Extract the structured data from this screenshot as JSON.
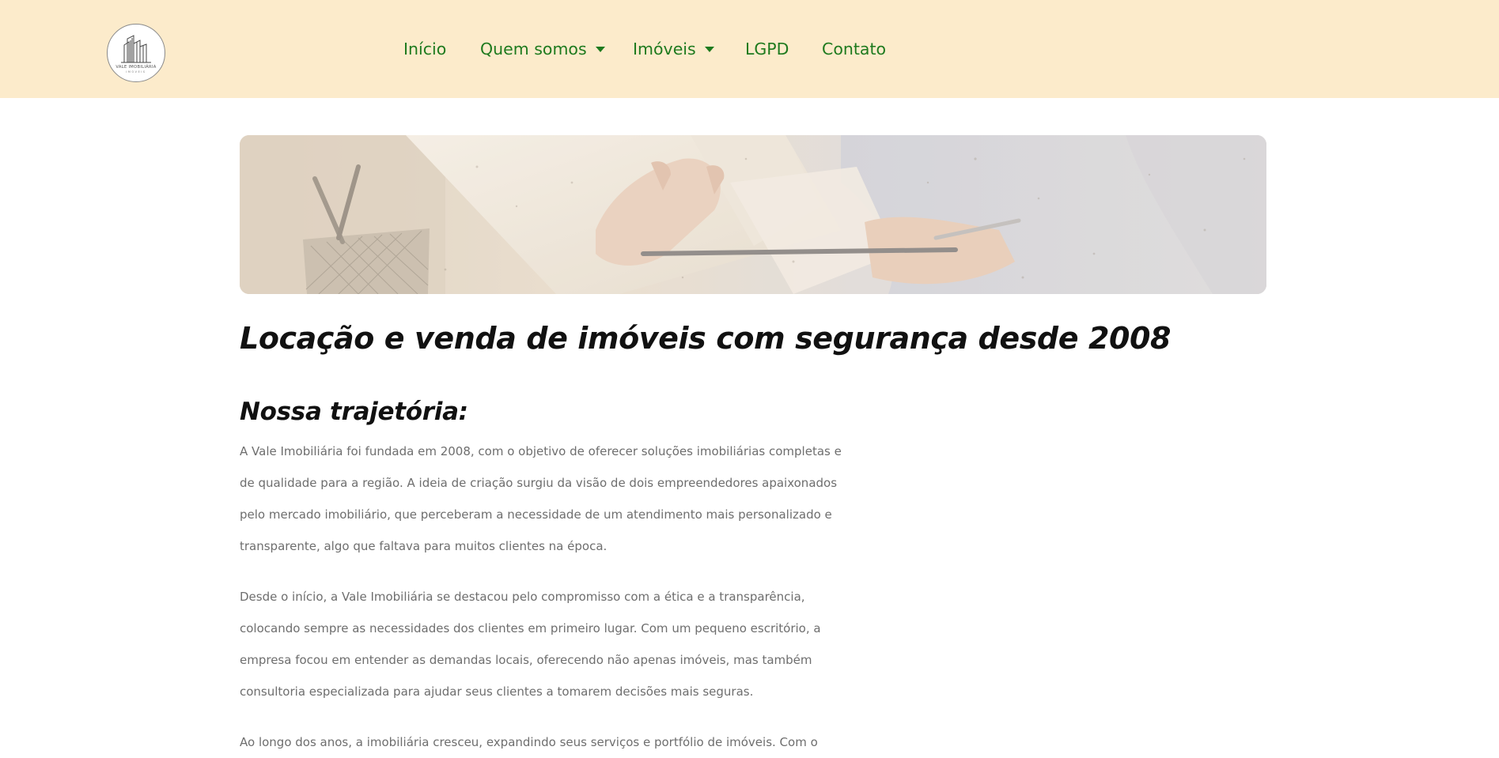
{
  "brand": {
    "logo_name": "VALE IMOBILIÁRIA",
    "logo_sub": "IMÓVEIS"
  },
  "nav": {
    "items": [
      {
        "label": "Início",
        "dropdown": false
      },
      {
        "label": "Quem somos",
        "dropdown": true
      },
      {
        "label": "Imóveis",
        "dropdown": true
      },
      {
        "label": "LGPD",
        "dropdown": false
      },
      {
        "label": "Contato",
        "dropdown": false
      }
    ]
  },
  "colors": {
    "navbar_bg": "#fcebcb",
    "nav_link": "#1e7a1e",
    "heading": "#111111",
    "body_text": "#6e6e6e"
  },
  "hero": {
    "image": "hands-signing-document-photo"
  },
  "main": {
    "title": "Locação e venda de imóveis com segurança desde 2008",
    "section_title": "Nossa trajetória:",
    "paragraphs": [
      {
        "lines": [
          "A Vale Imobiliária foi fundada em 2008, com o objetivo de oferecer soluções imobiliárias completas e",
          "de qualidade para a região. A ideia de criação surgiu da visão de dois empreendedores apaixonados",
          "pelo mercado imobiliário, que perceberam a necessidade de um atendimento mais personalizado e",
          "transparente, algo que faltava para muitos clientes na época."
        ]
      },
      {
        "lines": [
          "Desde o início, a Vale Imobiliária se destacou pelo compromisso com a ética e a transparência,",
          "colocando sempre as necessidades dos clientes em primeiro lugar. Com um pequeno escritório, a",
          "empresa focou em entender as demandas locais, oferecendo não apenas imóveis, mas também",
          "consultoria especializada para ajudar seus clientes a tomarem decisões mais seguras."
        ]
      },
      {
        "lines": [
          "Ao longo dos anos, a imobiliária cresceu, expandindo seus serviços e portfólio de imóveis. Com o"
        ]
      }
    ]
  }
}
